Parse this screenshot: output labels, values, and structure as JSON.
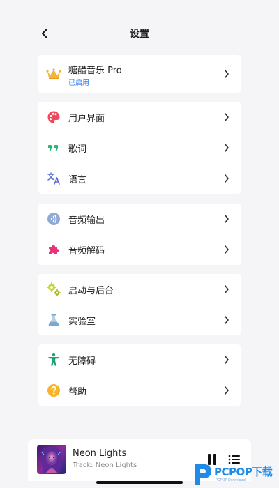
{
  "header": {
    "title": "设置"
  },
  "pro": {
    "title": "糖醋音乐 Pro",
    "status": "已启用"
  },
  "groups": [
    {
      "items": [
        {
          "label": "用户界面",
          "icon": "palette-icon"
        },
        {
          "label": "歌词",
          "icon": "quote-icon"
        },
        {
          "label": "语言",
          "icon": "translate-icon"
        }
      ]
    },
    {
      "items": [
        {
          "label": "音频输出",
          "icon": "audio-output-icon"
        },
        {
          "label": "音频解码",
          "icon": "puzzle-icon"
        }
      ]
    },
    {
      "items": [
        {
          "label": "启动与后台",
          "icon": "gears-icon"
        },
        {
          "label": "实验室",
          "icon": "flask-icon"
        }
      ]
    },
    {
      "items": [
        {
          "label": "无障碍",
          "icon": "accessibility-icon"
        },
        {
          "label": "帮助",
          "icon": "help-icon"
        }
      ]
    }
  ],
  "player": {
    "title": "Neon Lights",
    "subtitle": "Track: Neon Lights"
  },
  "watermark": {
    "text": "PCPOP下载",
    "subtext": "PCPOP Download"
  },
  "colors": {
    "background": "#f5f5f7",
    "card": "#ffffff",
    "accent_blue": "#2f7cf6",
    "crown": "#f5b43a",
    "palette": "#ee4a5a",
    "quote": "#2bb673",
    "translate": "#5b6bd6",
    "audio_output": "#8faad6",
    "puzzle": "#e8327a",
    "gears": "#c8d43a",
    "flask": "#7fa7c9",
    "accessibility": "#1fa27a",
    "help": "#f7b529"
  }
}
